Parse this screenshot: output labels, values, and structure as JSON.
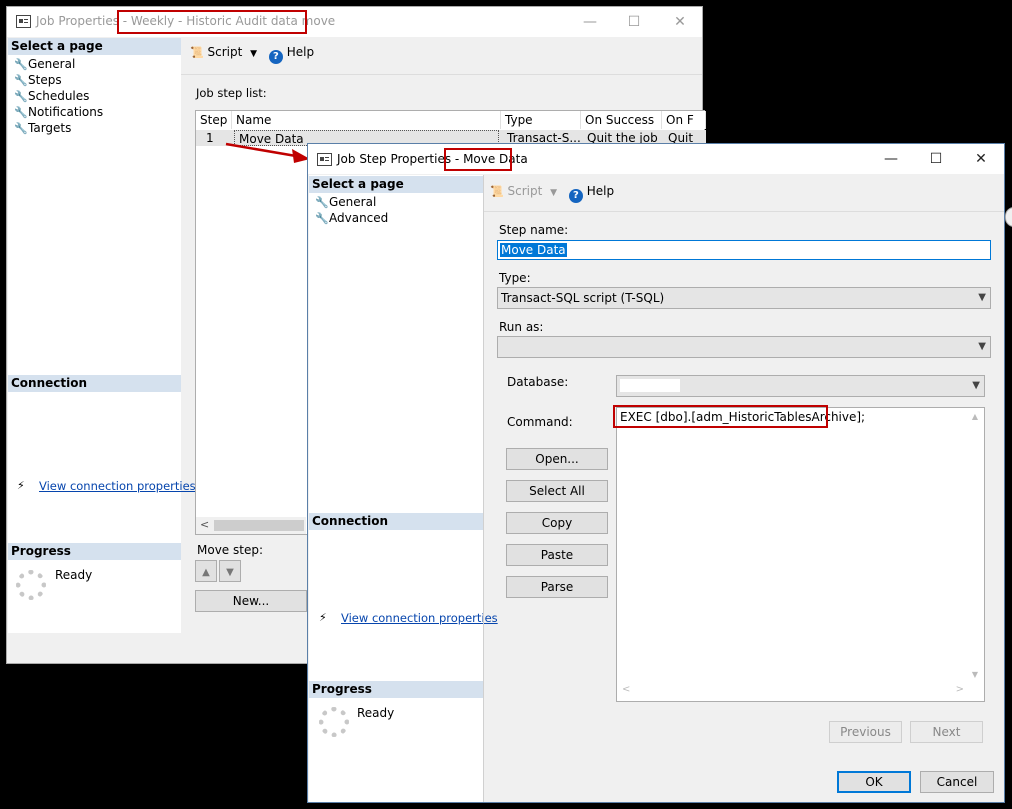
{
  "job_window": {
    "title_prefix": "Job Properties - ",
    "title_highlight": "Weekly - Historic Audit data move",
    "controls": {
      "minimize": "—",
      "maximize": "☐",
      "close": "✕"
    },
    "select_page_header": "Select a page",
    "pages": [
      "General",
      "Steps",
      "Schedules",
      "Notifications",
      "Targets"
    ],
    "connection_header": "Connection",
    "view_connection": "View connection properties",
    "progress_header": "Progress",
    "progress_status": "Ready",
    "toolbar": {
      "script": "Script",
      "help": "Help"
    },
    "job_step_list_label": "Job step list:",
    "table": {
      "columns": [
        "Step",
        "Name",
        "Type",
        "On Success",
        "On F"
      ],
      "rows": [
        {
          "step": "1",
          "name": "Move Data",
          "type": "Transact-S...",
          "on_success": "Quit the job ...",
          "on_failure": "Quit"
        }
      ]
    },
    "move_step_label": "Move step:",
    "new_button": "New..."
  },
  "step_window": {
    "title_prefix": "Job Step Properties - ",
    "title_highlight": "Move Data",
    "controls": {
      "minimize": "—",
      "maximize": "☐",
      "close": "✕"
    },
    "select_page_header": "Select a page",
    "pages": [
      "General",
      "Advanced"
    ],
    "connection_header": "Connection",
    "view_connection": "View connection properties",
    "progress_header": "Progress",
    "progress_status": "Ready",
    "toolbar": {
      "script": "Script",
      "help": "Help"
    },
    "step_name_label": "Step name:",
    "step_name_value": "Move Data",
    "type_label": "Type:",
    "type_value": "Transact-SQL script (T-SQL)",
    "run_as_label": "Run as:",
    "run_as_value": "",
    "database_label": "Database:",
    "database_value": "",
    "command_label": "Command:",
    "command_text": "EXEC [dbo].[adm_HistoricTablesArchive];",
    "buttons": {
      "open": "Open...",
      "select_all": "Select All",
      "copy": "Copy",
      "paste": "Paste",
      "parse": "Parse"
    },
    "previous": "Previous",
    "next": "Next",
    "ok": "OK",
    "cancel": "Cancel"
  },
  "colors": {
    "highlight_box": "#c00000",
    "section_header": "#d5e1ee",
    "link": "#0645ad",
    "selection": "#0078d7"
  }
}
